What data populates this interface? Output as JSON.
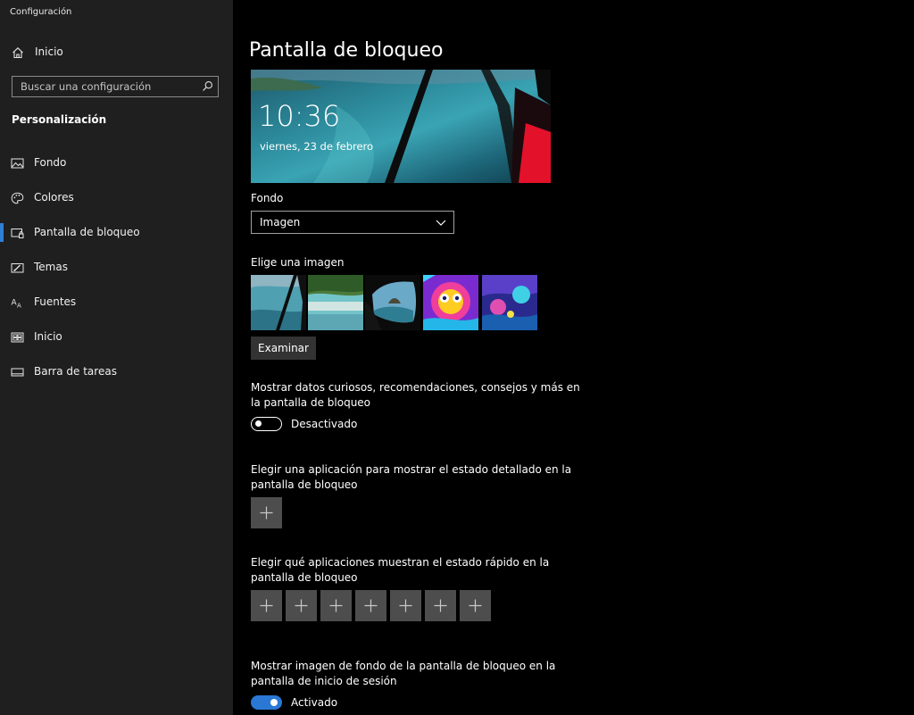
{
  "window": {
    "title": "Configuración"
  },
  "sidebar": {
    "home_label": "Inicio",
    "search_placeholder": "Buscar una configuración",
    "section_title": "Personalización",
    "items": [
      {
        "label": "Fondo",
        "icon": "image-icon",
        "active": false
      },
      {
        "label": "Colores",
        "icon": "palette-icon",
        "active": false
      },
      {
        "label": "Pantalla de bloqueo",
        "icon": "lock-screen-icon",
        "active": true
      },
      {
        "label": "Temas",
        "icon": "themes-icon",
        "active": false
      },
      {
        "label": "Fuentes",
        "icon": "fonts-icon",
        "active": false
      },
      {
        "label": "Inicio",
        "icon": "start-icon",
        "active": false
      },
      {
        "label": "Barra de tareas",
        "icon": "taskbar-icon",
        "active": false
      }
    ]
  },
  "main": {
    "title": "Pantalla de bloqueo",
    "preview": {
      "time": "10:36",
      "date": "viernes, 23 de febrero"
    },
    "background_label": "Fondo",
    "background_value": "Imagen",
    "choose_image_label": "Elige una imagen",
    "browse_button": "Examinar",
    "fun_facts_text": "Mostrar datos curiosos, recomendaciones, consejos y más en la pantalla de bloqueo",
    "fun_facts_state": "Desactivado",
    "detailed_status_text": "Elegir una aplicación para mostrar el estado detallado en la pantalla de bloqueo",
    "quick_status_text": "Elegir qué aplicaciones muestran el estado rápido en la pantalla de bloqueo",
    "signin_bg_text": "Mostrar imagen de fondo de la pantalla de bloqueo en la pantalla de inicio de sesión",
    "signin_bg_state": "Activado"
  },
  "colors": {
    "accent": "#2a78d4",
    "sidebar_bg": "#1f1f1f",
    "main_bg": "#000000",
    "tile_bg": "#4d4d4d"
  }
}
